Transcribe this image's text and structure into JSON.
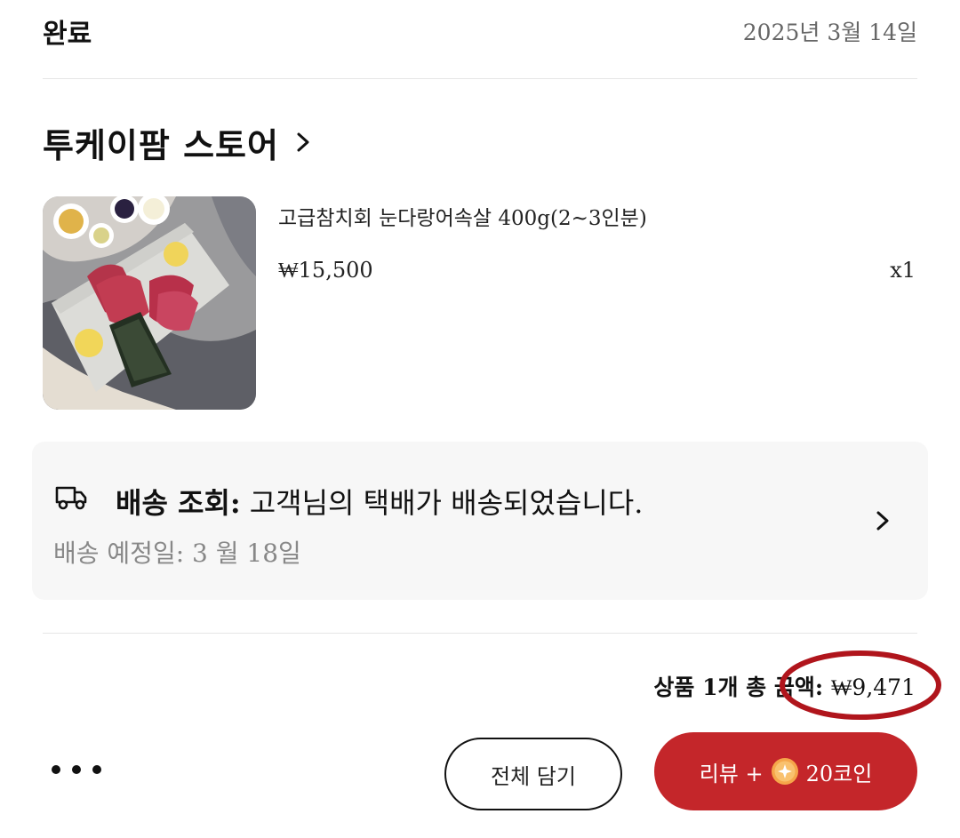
{
  "order": {
    "status": "완료",
    "date": "2025년 3월 14일"
  },
  "store": {
    "name": "투케이팜 스토어",
    "chevron_icon": "chevron-right-icon"
  },
  "product": {
    "title": "고급참치회 눈다랑어속살 400g(2~3인분)",
    "price": "₩15,500",
    "quantity": "x1",
    "thumbnail": "tuna-sashimi-photo"
  },
  "shipping": {
    "icon": "truck-icon",
    "label": "배송 조회:",
    "message": "고객님의 택배가 배송되었습니다.",
    "eta": "배송 예정일: 3 월 18일"
  },
  "total": {
    "label": "상품 1개 총 금액:",
    "value": "₩9,471",
    "highlight_color": "#b0151c"
  },
  "actions": {
    "more_icon": "more-dots-icon",
    "add_all_to_cart": "전체 담기",
    "review_prefix": "리뷰 +",
    "review_reward": "20코인",
    "coin_icon": "coin-icon"
  },
  "colors": {
    "accent": "#c4262a",
    "card_bg": "#f7f7f7",
    "muted_text": "#888888"
  }
}
